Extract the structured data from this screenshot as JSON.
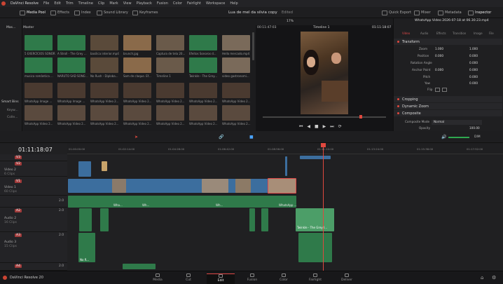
{
  "menu": {
    "app": "DaVinci Resolve",
    "items": [
      "File",
      "Edit",
      "Trim",
      "Timeline",
      "Clip",
      "Mark",
      "View",
      "Playback",
      "Fusion",
      "Color",
      "Fairlight",
      "Workspace",
      "Help"
    ]
  },
  "toolbar": {
    "media_pool": "Media Pool",
    "effects": "Effects",
    "index": "Index",
    "sound_library": "Sound Library",
    "keyframes": "Keyframes",
    "project_title": "Lua de mel da silvia copy",
    "project_status": "Edited",
    "quick_export": "Quick Export",
    "mixer": "Mixer",
    "metadata": "Metadata",
    "inspector": "Inspector"
  },
  "pool": {
    "bin_label": "Mas...",
    "master_label": "Master",
    "smart_bins": "Smart Bins",
    "keywords": "Keyw...",
    "collections": "Colle...",
    "clips": [
      "5 EXERCÍCIOS SONOR...",
      "A Stroll - The Grey ...",
      "basilica interior.mp4",
      "brunch.jpg",
      "Captura de tela 20...",
      "Efeitos Sonoros d...",
      "Hello mercado.mp4",
      "musica romântica ...",
      "NARUTO SAD SONG ...",
      "No Rush - Diploba...",
      "Som de claque. Ef...",
      "Timeline 1",
      "Twinkle - The Grey...",
      "video gastronomi...",
      "WhatsApp Image ...",
      "WhatsApp Image ...",
      "WhatsApp Video 2...",
      "WhatsApp Video 2...",
      "WhatsApp Video 2...",
      "WhatsApp Video 2...",
      "WhatsApp Video 2...",
      "WhatsApp Video 2...",
      "WhatsApp Video 2...",
      "WhatsApp Video 2...",
      "WhatsApp Video 2...",
      "WhatsApp Video 2...",
      "WhatsApp Video 2...",
      "WhatsApp Video 2..."
    ]
  },
  "viewer": {
    "zoom": "17%",
    "src_tc": "00:11:47:03",
    "timeline_name": "Timeline 1",
    "rec_tc": "01:11:18:07"
  },
  "inspector": {
    "clip_name": "WhatsApp Video 2026-07-18 at 06.30.23.mp4",
    "tabs": [
      "Video",
      "Audio",
      "Effects",
      "Transition",
      "Image",
      "File"
    ],
    "transform": "Transform",
    "zoom": "Zoom",
    "zoom_x": "1.000",
    "zoom_y": "1.000",
    "position": "Position",
    "pos_x": "0.000",
    "pos_y": "0.000",
    "rotation": "Rotation Angle",
    "rotation_val": "0.000",
    "anchor": "Anchor Point",
    "anchor_x": "0.000",
    "anchor_y": "0.000",
    "pitch": "Pitch",
    "pitch_val": "0.000",
    "yaw": "Yaw",
    "yaw_val": "0.000",
    "flip": "Flip",
    "cropping": "Cropping",
    "dynamic_zoom": "Dynamic Zoom",
    "composite": "Composite",
    "composite_mode": "Composite Mode",
    "composite_mode_val": "Normal",
    "opacity": "Opacity",
    "opacity_val": "100.00"
  },
  "timeline": {
    "timecode": "01:11:18:07",
    "ruler": [
      "01:00:00:00",
      "01:02:14:00",
      "01:04:28:00",
      "01:06:42:00",
      "01:08:56:00",
      "01:11:10:00",
      "01:13:24:00",
      "01:15:38:00",
      "01:17:52:00"
    ],
    "tracks": {
      "v3": "V3",
      "v2": "V2",
      "v2_name": "Video 2",
      "v2_clips": "6 Clips",
      "v1": "V1",
      "v1_name": "Video 1",
      "v1_clips": "60 Clips",
      "a2": "A2",
      "a2_name": "Audio 2",
      "a2_clips": "16 Clips",
      "a2_ch": "2.0",
      "a3": "A3",
      "a3_name": "Audio 3",
      "a3_clips": "15 Clips",
      "a3_ch": "2.0",
      "a4": "A4",
      "a4_ch": "2.0",
      "a1_ch": "2.0"
    },
    "clip_labels": {
      "wha1": "Wha...",
      "wha2": "Wh...",
      "wha3": "Wh...",
      "whats": "WhatsApp ...",
      "twinkle": "Twinkle - The Grey I...",
      "no": "No R..."
    },
    "dim": "DIM"
  },
  "footer": {
    "app": "DaVinci Resolve 20",
    "pages": [
      "Media",
      "Cut",
      "Edit",
      "Fusion",
      "Color",
      "Fairlight",
      "Deliver"
    ]
  },
  "colors": {
    "video_clip": "#3c6e9e",
    "audio_clip": "#2f7a4a",
    "accent_red": "#e0483e"
  }
}
